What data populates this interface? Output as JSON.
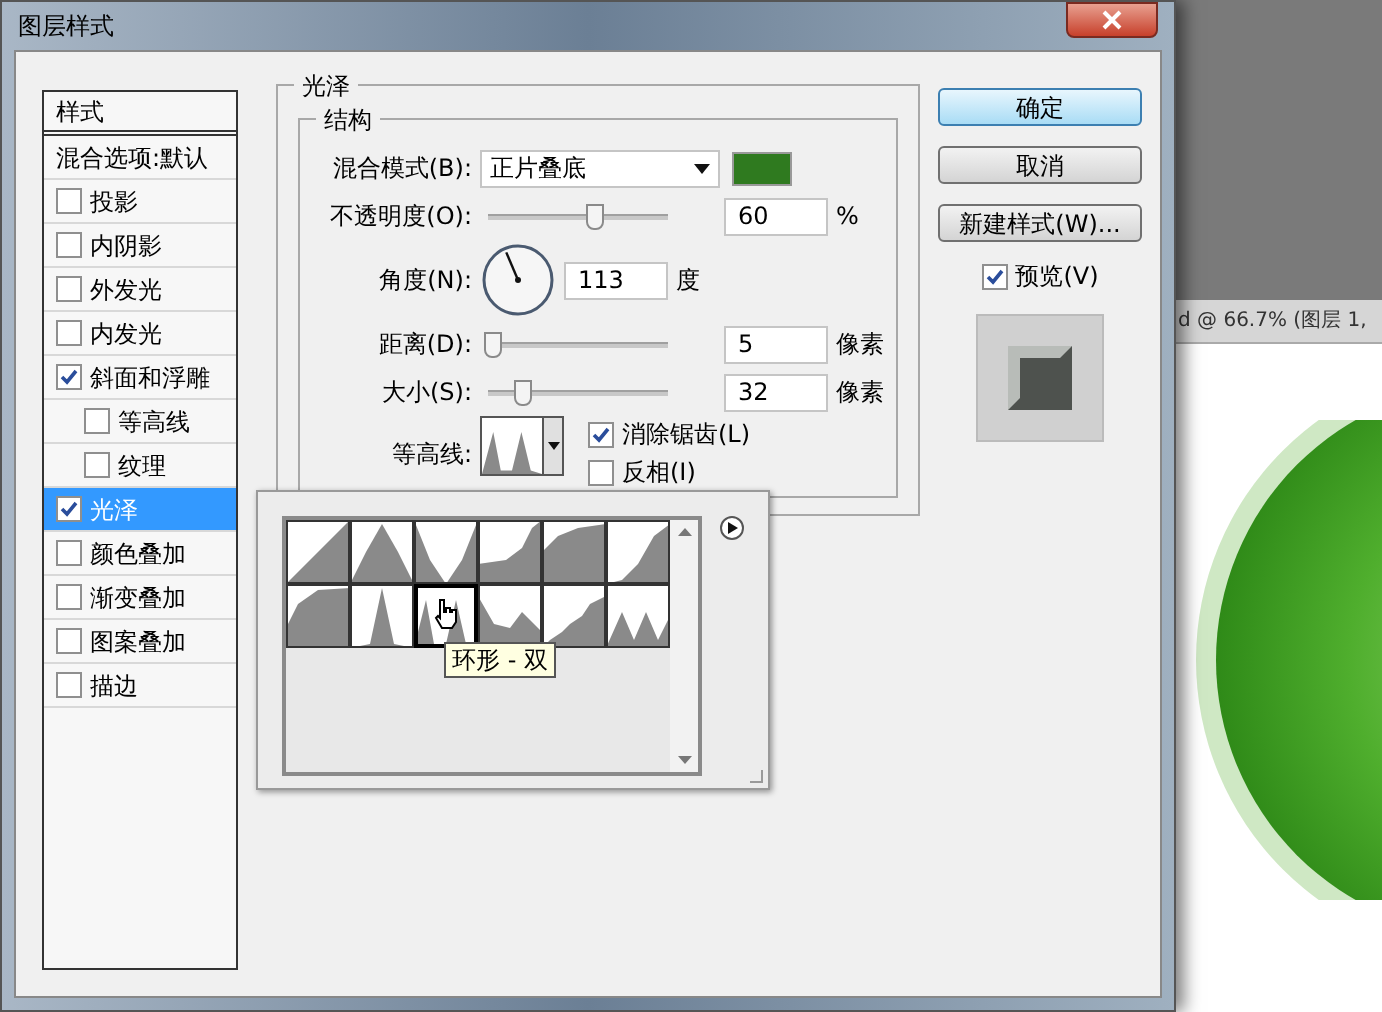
{
  "window": {
    "title": "图层样式"
  },
  "sidebar": {
    "header": "样式",
    "items": [
      {
        "label": "混合选项:默认",
        "kind": "plain",
        "selected": false
      },
      {
        "label": "投影",
        "kind": "check",
        "checked": false,
        "selected": false
      },
      {
        "label": "内阴影",
        "kind": "check",
        "checked": false,
        "selected": false
      },
      {
        "label": "外发光",
        "kind": "check",
        "checked": false,
        "selected": false
      },
      {
        "label": "内发光",
        "kind": "check",
        "checked": false,
        "selected": false
      },
      {
        "label": "斜面和浮雕",
        "kind": "check",
        "checked": true,
        "selected": false,
        "children": [
          {
            "label": "等高线",
            "kind": "check",
            "checked": false,
            "selected": false
          },
          {
            "label": "纹理",
            "kind": "check",
            "checked": false,
            "selected": false
          }
        ]
      },
      {
        "label": "光泽",
        "kind": "check",
        "checked": true,
        "selected": true
      },
      {
        "label": "颜色叠加",
        "kind": "check",
        "checked": false,
        "selected": false
      },
      {
        "label": "渐变叠加",
        "kind": "check",
        "checked": false,
        "selected": false
      },
      {
        "label": "图案叠加",
        "kind": "check",
        "checked": false,
        "selected": false
      },
      {
        "label": "描边",
        "kind": "check",
        "checked": false,
        "selected": false
      }
    ]
  },
  "panel": {
    "title": "光泽",
    "group": "结构",
    "blend_mode": {
      "label": "混合模式(B):",
      "value": "正片叠底",
      "color": "#2f7a1f"
    },
    "opacity": {
      "label": "不透明度(O):",
      "level": 0.6,
      "value": "60",
      "unit": "%"
    },
    "angle": {
      "label": "角度(N):",
      "value": "113",
      "unit": "度"
    },
    "distance": {
      "label": "距离(D):",
      "level": 0.02,
      "value": "5",
      "unit": "像素"
    },
    "size": {
      "label": "大小(S):",
      "level": 0.19,
      "value": "32",
      "unit": "像素"
    },
    "contour": {
      "label": "等高线:"
    },
    "anti_alias": {
      "label": "消除锯齿(L)",
      "checked": true
    },
    "invert": {
      "label": "反相(I)",
      "checked": false
    }
  },
  "contour_picker": {
    "tooltip": "环形 - 双",
    "presets": [
      {
        "selected": false
      },
      {
        "selected": false
      },
      {
        "selected": false
      },
      {
        "selected": false
      },
      {
        "selected": false
      },
      {
        "selected": false
      },
      {
        "selected": false
      },
      {
        "selected": false
      },
      {
        "selected": true
      },
      {
        "selected": false
      },
      {
        "selected": false
      },
      {
        "selected": false
      }
    ]
  },
  "buttons": [
    {
      "label": "确定",
      "kind": "default"
    },
    {
      "label": "取消",
      "kind": "normal"
    },
    {
      "label": "新建样式(W)...",
      "kind": "normal"
    }
  ],
  "preview": {
    "label": "预览(V)",
    "checked": true
  },
  "document": {
    "title": "d @ 66.7% (图层 1,"
  }
}
